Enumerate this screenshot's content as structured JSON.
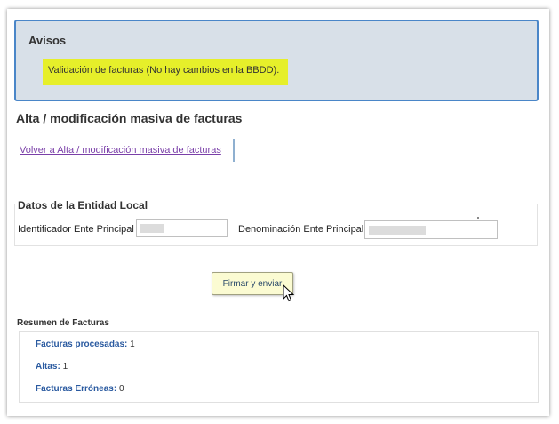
{
  "avisos": {
    "title": "Avisos",
    "message": "Validación de facturas (No hay cambios en la BBDD)."
  },
  "page": {
    "title": "Alta / modificación masiva de facturas",
    "back_link": "Volver a Alta / modificación masiva de facturas"
  },
  "entidad": {
    "legend": "Datos de la Entidad Local",
    "identificador_label": "Identificador Ente Principal",
    "identificador_value": "",
    "denominacion_label": "Denominación Ente Principal",
    "denominacion_value": ""
  },
  "actions": {
    "submit_label": "Firmar y enviar"
  },
  "resumen": {
    "title": "Resumen de Facturas",
    "rows": [
      {
        "label": "Facturas procesadas:",
        "value": "1"
      },
      {
        "label": "Altas:",
        "value": "1"
      },
      {
        "label": "Facturas Erróneas:",
        "value": "0"
      }
    ]
  },
  "colors": {
    "highlight": "#e6ef2a",
    "avisos_bg": "#d8e0e8",
    "avisos_border": "#4a86c8",
    "link": "#7a3fa8",
    "summary_label": "#2a5aa0"
  }
}
